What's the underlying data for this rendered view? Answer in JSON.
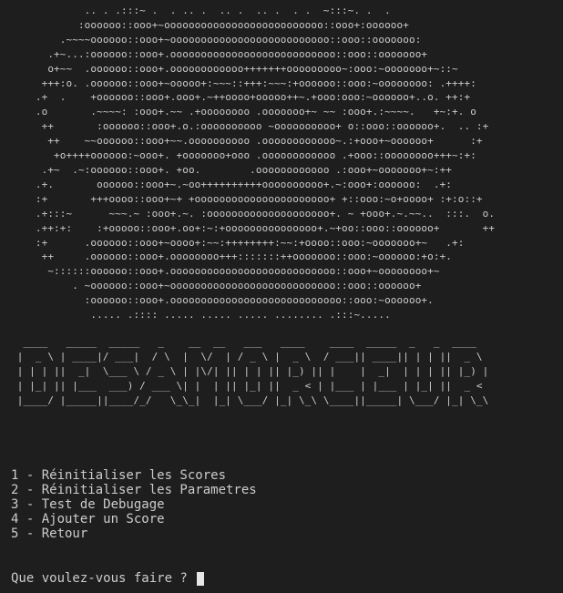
{
  "terminal": {
    "ascii_art": "            .. . .:::~ .  . .. .  .. .  .. .  . .  ~:::~. .  .\n           :oooooo::ooo+~oooooooooooooooooooooooooo::ooo+:oooooo+\n        .~~~~oooooo::ooo+~oooooooooooooooooooooooooo::ooo::ooooooo:\n      .+~...:oooooo::ooo+.ooooooooooooooooooooooooooo::ooo::ooooooo+\n      o+~~  .oooooo::ooo+.oooooooooooo+++++++ooooooooo~:ooo:~ooooooo+~::~\n     +++:o. .oooooo::ooo+~ooooo+:~~~::+++:~~~:+oooooo::ooo:~oooooooo: .++++:\n    .+  .    +oooooo::ooo+.ooo+.~++oooo+ooooo++~.+ooo:ooo:~oooooo+..o. ++:+\n    .o       .~~~~: :ooo+.~~ .+oooooooo .ooooooo+~ ~~ :ooo+.:~~~~.   +~:+. o\n     ++       :oooooo::ooo+.o.:oooooooooo ~oooooooooo+ o::ooo::oooooo+.  .. :+\n      ++    ~~oooooo::ooo+~~.oooooooooo .oooooooooooo~.:+ooo+~oooooo+      :+\n       +o++++oooooo:~ooo+. +ooooooo+ooo .oooooooooooo .+ooo::oooooooo+++~:+:\n     .+~  .~:oooooo::ooo+. +oo.        .oooooooooooo .:ooo+~ooooooo+~:++\n    .+.       oooooo::ooo+~.~oo++++++++++oooooooooo+.~:ooo+:oooooo:  .+:\n    :+       +++oooo::ooo+~+ +oooooooooooooooooooooo+ +::ooo:~o+oooo+ :+:o::+\n    .+:::~      ~~~.~ :ooo+.~. :oooooooooooooooooooo+. ~ +ooo+.~.~~..  :::.  o.\n    .++:+:    :+ooooo::ooo+.oo+:~:+ooooooooooooooo+.~+oo::ooo::oooooo+       ++\n    :+      .oooooo::ooo+~oooo+:~~:++++++++:~~:+oooo::ooo:~ooooooo+~   .+:\n     ++     .oooooo::ooo+.oooooooo+++:::::::++ooooooo::ooo:~oooooo:+o:+.\n      ~::::::oooooo::ooo+.ooooooooooooooooooooooooooo::ooo+~oooooooo+~\n          . ~oooooo::ooo+~ooooooooooooooooooooooooooo::ooo::oooooo+\n            :oooooo::ooo+.oooooooooooooooooooooooooooo::ooo:~oooooo+.\n             ..... .:::: ..... ..... ..... ........ .:::~.....",
    "banner_art": "  ____   _____  _____   _    __  __   ___   ____    ____  _____  _   _  ____\n |  _ \\ | ____|/ ___|  / \\  |  \\/  | / _ \\ |  _ \\  / ___|| ____|| | | ||  _ \\\n | | | ||  _|  \\___ \\ / _ \\ | |\\/| || | | || |_) || |    |  _|  | | | || |_) |\n | |_| || |___  ___) / ___ \\| |  | || |_| ||  _ < | |___ | |___ | |_| ||  _ <\n |____/ |_____||____/_/   \\_\\_|  |_| \\___/ |_| \\_\\ \\____||_____| \\___/ |_| \\_\\",
    "menu": [
      "1 - Réinitialiser les Scores",
      "2 - Réinitialiser les Parametres",
      "3 - Test de Debugage",
      "4 - Ajouter un Score",
      "5 - Retour"
    ],
    "prompt": "Que voulez-vous faire ? "
  },
  "colors": {
    "background": "#1e1e1e",
    "text": "#cccccc",
    "cursor": "#e6e6e6"
  }
}
